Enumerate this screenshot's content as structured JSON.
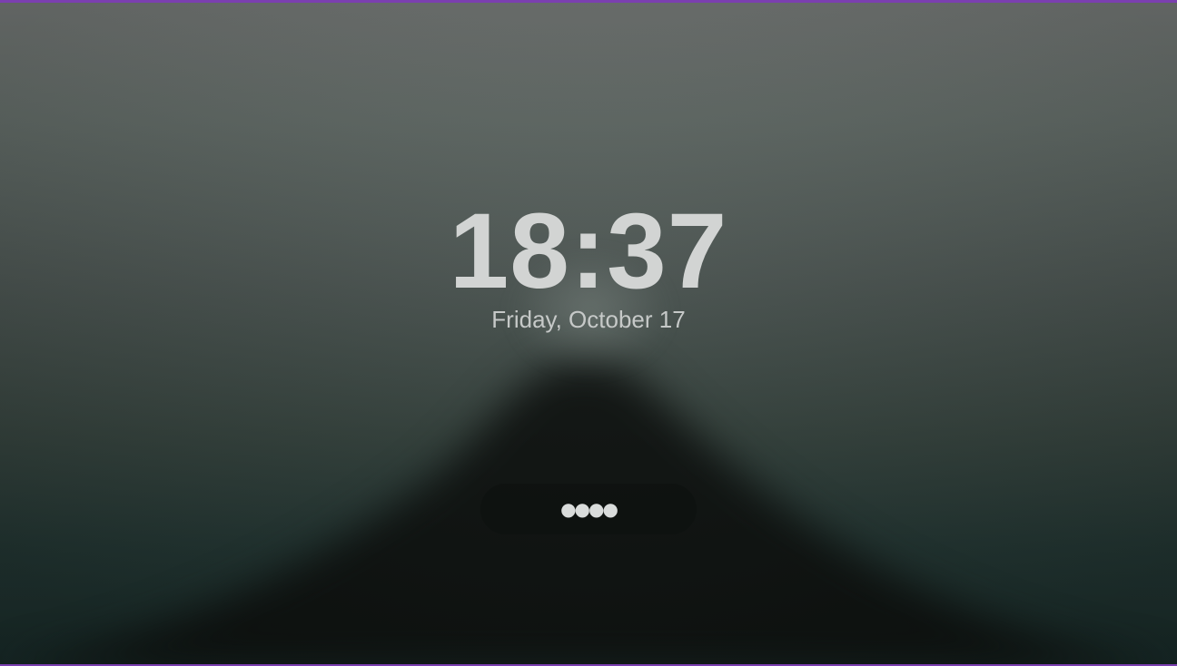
{
  "lock_screen": {
    "time": "18:37",
    "date": "Friday, October 17",
    "password": {
      "masked_value": "●●●●",
      "length": 4
    }
  },
  "colors": {
    "frame_border": "#7b3fb0",
    "text": "#d2d4d3",
    "background_top": "#6e7270",
    "background_bottom": "#172826"
  }
}
